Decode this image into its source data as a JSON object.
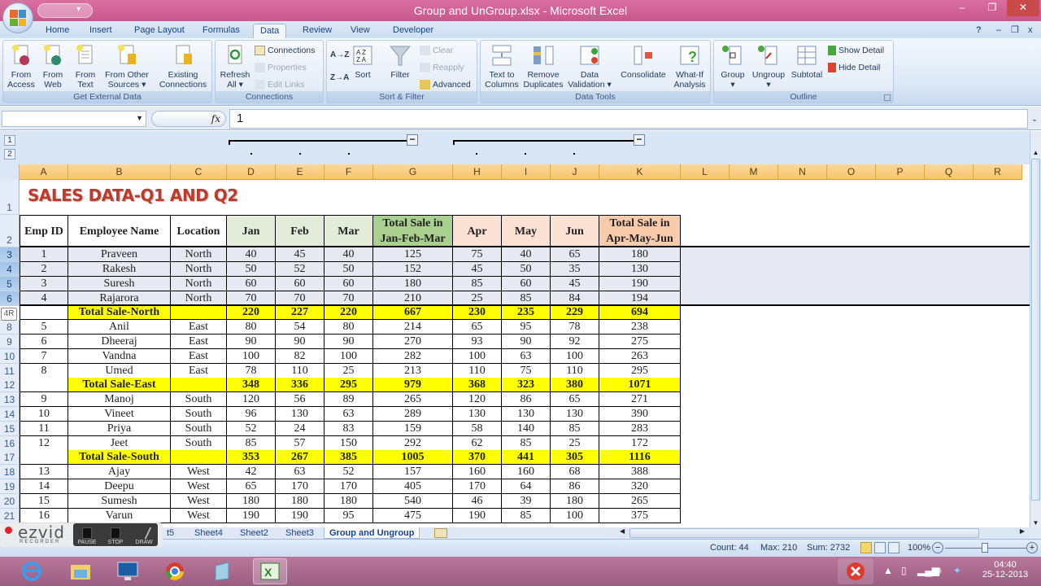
{
  "window": {
    "title": "Group and UnGroup.xlsx - Microsoft Excel",
    "controls": {
      "minimize": "–",
      "restore": "❐",
      "close": "✕"
    },
    "app_controls": {
      "help": "?",
      "minimize": "–",
      "restore": "❐",
      "close": "x"
    }
  },
  "ribbon_tabs": [
    "Home",
    "Insert",
    "Page Layout",
    "Formulas",
    "Data",
    "Review",
    "View",
    "Developer"
  ],
  "active_tab": "Data",
  "ribbon": {
    "get_external_data": {
      "label": "Get External Data",
      "buttons": [
        {
          "line1": "From",
          "line2": "Access",
          "icon": "access-db-icon"
        },
        {
          "line1": "From",
          "line2": "Web",
          "icon": "web-globe-icon"
        },
        {
          "line1": "From",
          "line2": "Text",
          "icon": "text-file-icon"
        },
        {
          "line1": "From Other",
          "line2": "Sources ▾",
          "icon": "other-sources-icon"
        },
        {
          "line1": "Existing",
          "line2": "Connections",
          "icon": "existing-connections-icon"
        }
      ]
    },
    "connections": {
      "label": "Connections",
      "refresh": {
        "line1": "Refresh",
        "line2": "All ▾"
      },
      "small": [
        {
          "label": "Connections",
          "enabled": true
        },
        {
          "label": "Properties",
          "enabled": false
        },
        {
          "label": "Edit Links",
          "enabled": false
        }
      ]
    },
    "sort_filter": {
      "label": "Sort & Filter",
      "sort_az": "A→Z",
      "sort_za": "Z→A",
      "sort": "Sort",
      "filter": "Filter",
      "small": [
        {
          "label": "Clear",
          "enabled": false
        },
        {
          "label": "Reapply",
          "enabled": false
        },
        {
          "label": "Advanced",
          "enabled": true
        }
      ]
    },
    "data_tools": {
      "label": "Data Tools",
      "buttons": [
        {
          "line1": "Text to",
          "line2": "Columns"
        },
        {
          "line1": "Remove",
          "line2": "Duplicates"
        },
        {
          "line1": "Data",
          "line2": "Validation ▾"
        },
        {
          "line1": "Consolidate",
          "line2": ""
        },
        {
          "line1": "What-If",
          "line2": "Analysis ▾"
        }
      ]
    },
    "outline": {
      "label": "Outline",
      "buttons": [
        {
          "line1": "Group",
          "line2": "▾"
        },
        {
          "line1": "Ungroup",
          "line2": "▾"
        },
        {
          "line1": "Subtotal",
          "line2": ""
        }
      ],
      "small": [
        {
          "label": "Show Detail"
        },
        {
          "label": "Hide Detail"
        }
      ]
    }
  },
  "formula_bar": {
    "name_box": "",
    "fx": "fx",
    "value": "1"
  },
  "outline_levels": [
    "1",
    "2"
  ],
  "columns": [
    "A",
    "B",
    "C",
    "D",
    "E",
    "F",
    "G",
    "H",
    "I",
    "J",
    "K",
    "L",
    "M",
    "N",
    "O",
    "P",
    "Q",
    "R"
  ],
  "sheet": {
    "title": "SALES DATA-Q1 AND Q2",
    "headers": [
      "Emp ID",
      "Employee Name",
      "Location",
      "Jan",
      "Feb",
      "Mar",
      "Total Sale in Jan-Feb-Mar",
      "Apr",
      "May",
      "Jun",
      "Total Sale in Apr-May-Jun"
    ],
    "row_numbers": [
      "1",
      "2",
      "3",
      "4",
      "5",
      "6",
      "8",
      "9",
      "10",
      "11",
      "12",
      "13",
      "14",
      "15",
      "16",
      "17",
      "18",
      "19",
      "20",
      "21"
    ],
    "rows": [
      {
        "row": "3",
        "type": "data",
        "cells": [
          "1",
          "Praveen",
          "North",
          "40",
          "45",
          "40",
          "125",
          "75",
          "40",
          "65",
          "180"
        ]
      },
      {
        "row": "4",
        "type": "data",
        "cells": [
          "2",
          "Rakesh",
          "North",
          "50",
          "52",
          "50",
          "152",
          "45",
          "50",
          "35",
          "130"
        ]
      },
      {
        "row": "5",
        "type": "data",
        "cells": [
          "3",
          "Suresh",
          "North",
          "60",
          "60",
          "60",
          "180",
          "85",
          "60",
          "45",
          "190"
        ]
      },
      {
        "row": "6",
        "type": "data",
        "cells": [
          "4",
          "Rajarora",
          "North",
          "70",
          "70",
          "70",
          "210",
          "25",
          "85",
          "84",
          "194"
        ]
      },
      {
        "row": "7",
        "type": "total",
        "cells": [
          "",
          "Total Sale-North",
          "",
          "220",
          "227",
          "220",
          "667",
          "230",
          "235",
          "229",
          "694"
        ]
      },
      {
        "row": "8",
        "type": "data",
        "cells": [
          "5",
          "Anil",
          "East",
          "80",
          "54",
          "80",
          "214",
          "65",
          "95",
          "78",
          "238"
        ]
      },
      {
        "row": "9",
        "type": "data",
        "cells": [
          "6",
          "Dheeraj",
          "East",
          "90",
          "90",
          "90",
          "270",
          "93",
          "90",
          "92",
          "275"
        ]
      },
      {
        "row": "10",
        "type": "data",
        "cells": [
          "7",
          "Vandna",
          "East",
          "100",
          "82",
          "100",
          "282",
          "100",
          "63",
          "100",
          "263"
        ]
      },
      {
        "row": "11",
        "type": "data",
        "cells": [
          "8",
          "Umed",
          "East",
          "78",
          "110",
          "25",
          "213",
          "110",
          "75",
          "110",
          "295"
        ]
      },
      {
        "row": "12",
        "type": "total",
        "cells": [
          "",
          "Total Sale-East",
          "",
          "348",
          "336",
          "295",
          "979",
          "368",
          "323",
          "380",
          "1071"
        ]
      },
      {
        "row": "13",
        "type": "data",
        "cells": [
          "9",
          "Manoj",
          "South",
          "120",
          "56",
          "89",
          "265",
          "120",
          "86",
          "65",
          "271"
        ]
      },
      {
        "row": "14",
        "type": "data",
        "cells": [
          "10",
          "Vineet",
          "South",
          "96",
          "130",
          "63",
          "289",
          "130",
          "130",
          "130",
          "390"
        ]
      },
      {
        "row": "15",
        "type": "data",
        "cells": [
          "11",
          "Priya",
          "South",
          "52",
          "24",
          "83",
          "159",
          "58",
          "140",
          "85",
          "283"
        ]
      },
      {
        "row": "16",
        "type": "data",
        "cells": [
          "12",
          "Jeet",
          "South",
          "85",
          "57",
          "150",
          "292",
          "62",
          "85",
          "25",
          "172"
        ]
      },
      {
        "row": "17",
        "type": "total",
        "cells": [
          "",
          "Total Sale-South",
          "",
          "353",
          "267",
          "385",
          "1005",
          "370",
          "441",
          "305",
          "1116"
        ]
      },
      {
        "row": "18",
        "type": "data",
        "cells": [
          "13",
          "Ajay",
          "West",
          "42",
          "63",
          "52",
          "157",
          "160",
          "160",
          "68",
          "388"
        ]
      },
      {
        "row": "19",
        "type": "data",
        "cells": [
          "14",
          "Deepu",
          "West",
          "65",
          "170",
          "170",
          "405",
          "170",
          "64",
          "86",
          "320"
        ]
      },
      {
        "row": "20",
        "type": "data",
        "cells": [
          "15",
          "Sumesh",
          "West",
          "180",
          "180",
          "180",
          "540",
          "46",
          "39",
          "180",
          "265"
        ]
      },
      {
        "row": "21",
        "type": "data",
        "cells": [
          "16",
          "Varun",
          "West",
          "190",
          "190",
          "95",
          "475",
          "190",
          "85",
          "100",
          "375"
        ]
      }
    ],
    "selection_tooltip": "4R"
  },
  "sheet_tabs": [
    "t5",
    "Sheet4",
    "Sheet2",
    "Sheet3",
    "Group and Ungroup"
  ],
  "active_sheet": "Group and Ungroup",
  "status": {
    "count": "Count: 44",
    "max": "Max: 210",
    "sum": "Sum: 2732",
    "zoom": "100%"
  },
  "ezvid": {
    "logo": "ezvid",
    "sub": "RECORDER",
    "buttons": [
      "PAUSE",
      "STOP",
      "DRAW"
    ]
  },
  "taskbar": {
    "apps": [
      "internet-explorer",
      "file-explorer",
      "lenovo-monitor",
      "chrome",
      "notepad",
      "excel"
    ],
    "time": "04:40",
    "date": "25-12-2013"
  },
  "colors": {
    "title_red": "#c0392b",
    "total_yellow": "#ffff00",
    "q1_header": "#e2ecd9",
    "q1_total_header": "#a9d08e",
    "q2_header": "#fbe2d5",
    "q2_total_header": "#f8cbad"
  }
}
